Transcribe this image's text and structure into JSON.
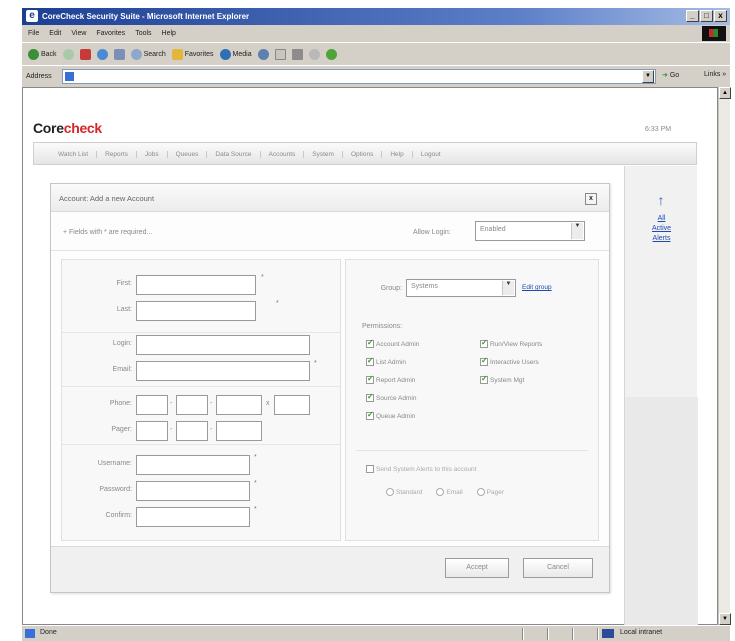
{
  "window": {
    "title": "CoreCheck Security Suite - Microsoft Internet Explorer",
    "controls": [
      "_",
      "□",
      "x"
    ]
  },
  "menu": [
    "File",
    "Edit",
    "View",
    "Favorites",
    "Tools",
    "Help"
  ],
  "toolbar": {
    "back": "Back",
    "search": "Search",
    "favorites": "Favorites",
    "media": "Media"
  },
  "address": {
    "label": "Address",
    "url": "",
    "go": "Go",
    "links": "Links"
  },
  "app": {
    "logo_main": "Core",
    "logo_accent": "check",
    "clock": "6:33 PM",
    "nav": [
      "Watch List",
      "Reports",
      "Jobs",
      "Queues",
      "Data Source",
      "Accounts",
      "System",
      "Options",
      "Help",
      "Logout"
    ],
    "side_links": [
      "All",
      "Active",
      "Alerts"
    ]
  },
  "dialog": {
    "title": "Account: Add a new Account",
    "required_note": "+ Fields with * are required...",
    "allow_login_label": "Allow Login:",
    "allow_login_value": "Enabled",
    "fields": {
      "first": "First:",
      "last": "Last:",
      "login": "Login:",
      "email": "Email:",
      "phone": "Phone:",
      "pager": "Pager:",
      "username": "Username:",
      "password": "Password:",
      "confirm": "Confirm:"
    },
    "required_mark": "*",
    "ext_mark": "x",
    "group_label": "Group:",
    "group_value": "Systems",
    "group_link": "Edit group",
    "permissions_label": "Permissions:",
    "permissions": [
      {
        "label": "Account Admin",
        "checked": true
      },
      {
        "label": "Run/View Reports",
        "checked": true
      },
      {
        "label": "List Admin",
        "checked": true
      },
      {
        "label": "Interactive Users",
        "checked": true
      },
      {
        "label": "Report Admin",
        "checked": true
      },
      {
        "label": "System Mgt",
        "checked": true
      },
      {
        "label": "Source Admin",
        "checked": true
      },
      {
        "label": "Queue Admin",
        "checked": true
      }
    ],
    "alerts_label": "Send System Alerts to this account",
    "alert_options": [
      "Standard",
      "Email",
      "Pager"
    ],
    "accept": "Accept",
    "cancel": "Cancel"
  },
  "status": {
    "text": "Done",
    "zone": "Local intranet"
  }
}
